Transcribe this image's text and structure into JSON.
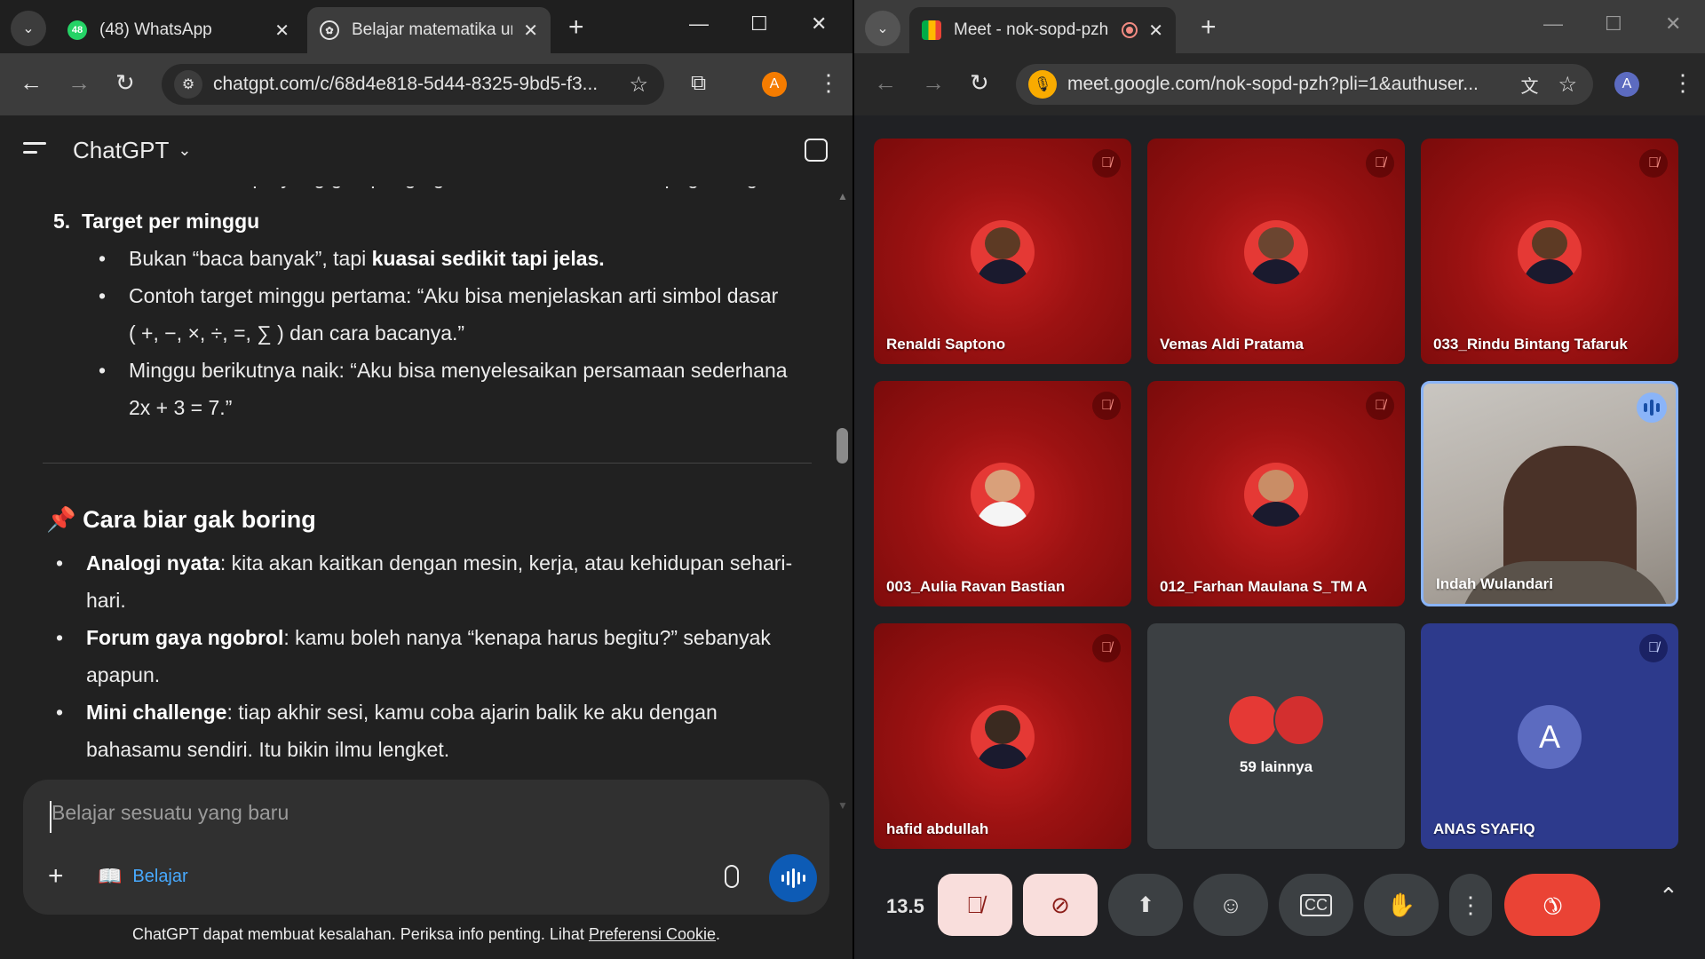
{
  "left_window": {
    "tabs": [
      {
        "title": "(48) WhatsApp",
        "badge": "48"
      },
      {
        "title": "Belajar matematika un"
      }
    ],
    "url": "chatgpt.com/c/68d4e818-5d44-8325-9bd5-f3...",
    "profile_initial": "A",
    "app_title": "ChatGPT",
    "content": {
      "cut_line": "Kalau kamu tipe yang gampang ngantuk malam, lebih baik pagi/siang.",
      "item5_num": "5.",
      "item5_title": "Target per minggu",
      "b1_pre": "Bukan “baca banyak”, tapi ",
      "b1_bold": "kuasai sedikit tapi jelas.",
      "b2_line1": "Contoh target minggu pertama: “Aku bisa menjelaskan arti simbol dasar",
      "b2_line2": "( +, −, ×, ÷, =, ∑ ) dan cara bacanya.”",
      "b3_line1": "Minggu berikutnya naik: “Aku bisa menyelesaikan persamaan sederhana",
      "b3_line2": "2x + 3 = 7.”",
      "section_emoji": "📌",
      "section_title": "Cara biar gak boring",
      "s1_bold": "Analogi nyata",
      "s1_line1": ": kita akan kaitkan dengan mesin, kerja, atau kehidupan sehari-",
      "s1_line2": "hari.",
      "s2_bold": "Forum gaya ngobrol",
      "s2_line1": ": kamu boleh nanya “kenapa harus begitu?” sebanyak",
      "s2_line2": "apapun.",
      "s3_bold": "Mini challenge",
      "s3_line1": ": tiap akhir sesi, kamu coba ajarin balik ke aku dengan",
      "s3_line2": "bahasamu sendiri. Itu bikin ilmu lengket."
    },
    "composer": {
      "placeholder": "Belajar sesuatu yang baru",
      "tool_label": "Belajar"
    },
    "disclaimer_text": "ChatGPT dapat membuat kesalahan. Periksa info penting. Lihat ",
    "disclaimer_link": "Preferensi Cookie",
    "disclaimer_end": "."
  },
  "right_window": {
    "tab_title": "Meet - nok-sopd-pzh",
    "url": "meet.google.com/nok-sopd-pzh?pli=1&authuser...",
    "profile_initial": "A",
    "participants": [
      {
        "name": "Renaldi Saptono",
        "muted": true
      },
      {
        "name": "Vemas Aldi Pratama",
        "muted": true
      },
      {
        "name": "033_Rindu Bintang Tafaruk",
        "muted": true
      },
      {
        "name": "003_Aulia Ravan Bastian",
        "muted": true
      },
      {
        "name": "012_Farhan Maulana S_TM A",
        "muted": true
      },
      {
        "name": "Indah Wulandari",
        "muted": false,
        "speaking": true
      },
      {
        "name": "hafid abdullah",
        "muted": true
      }
    ],
    "others_label": "59 lainnya",
    "anas": {
      "name": "ANAS SYAFIQ",
      "initial": "A"
    },
    "time": "13.5",
    "colors": {
      "tile_red": "#9c1212",
      "end_call": "#ea4335",
      "muted_btn": "#f9dedc",
      "anas_tile": "#2d3a8c"
    }
  }
}
